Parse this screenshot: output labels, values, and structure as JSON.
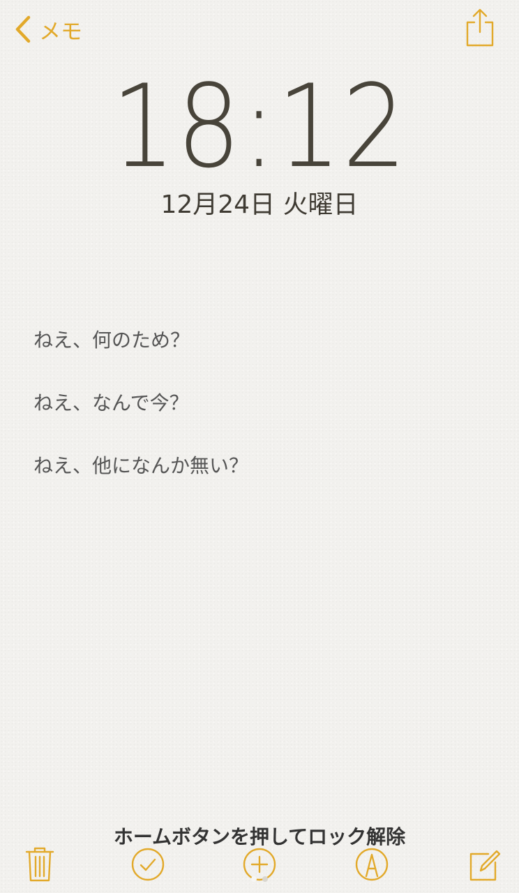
{
  "nav": {
    "back_label": "メモ",
    "back_icon": "chevron-left-icon",
    "share_icon": "share-icon"
  },
  "lockscreen": {
    "time": "18:12",
    "date": "12月24日 火曜日",
    "unlock_hint": "ホームボタンを押してロック解除"
  },
  "note": {
    "lines": [
      "ねえ、何のため？",
      "ねえ、なんで今？",
      "ねえ、他になんか無い？"
    ]
  },
  "toolbar": {
    "items": [
      {
        "icon": "trash-icon"
      },
      {
        "icon": "checkmark-circle-icon"
      },
      {
        "icon": "plus-circle-icon"
      },
      {
        "icon": "markup-pen-icon"
      },
      {
        "icon": "compose-icon"
      }
    ]
  },
  "page_indicator": {
    "count": 2,
    "active_index": 0
  },
  "colors": {
    "accent": "#e2a92a",
    "clock_text": "#48443a",
    "paper": "#f2f1ee"
  }
}
